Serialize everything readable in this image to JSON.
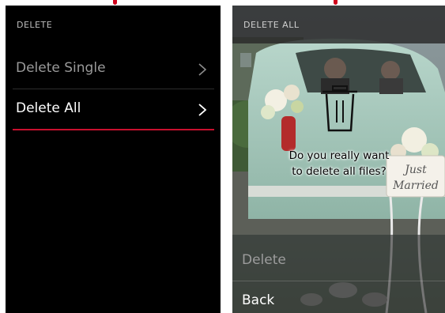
{
  "left_screen": {
    "title": "DELETE",
    "items": [
      {
        "label": "Delete Single",
        "state": "normal"
      },
      {
        "label": "Delete All",
        "state": "selected"
      }
    ]
  },
  "right_screen": {
    "title": "DELETE ALL",
    "dialog": {
      "question_line1": "Do you really want",
      "question_line2": "to delete all files?",
      "icon": "trash-icon"
    },
    "options": [
      {
        "label": "Delete",
        "state": "dimmed"
      },
      {
        "label": "Back",
        "state": "normal"
      }
    ],
    "background_image": "wedding car with 'Just Married' sign",
    "photo_sign_line1": "Just",
    "photo_sign_line2": "Married"
  },
  "colors": {
    "accent": "#c8102e",
    "arrow": "#d0021b"
  }
}
